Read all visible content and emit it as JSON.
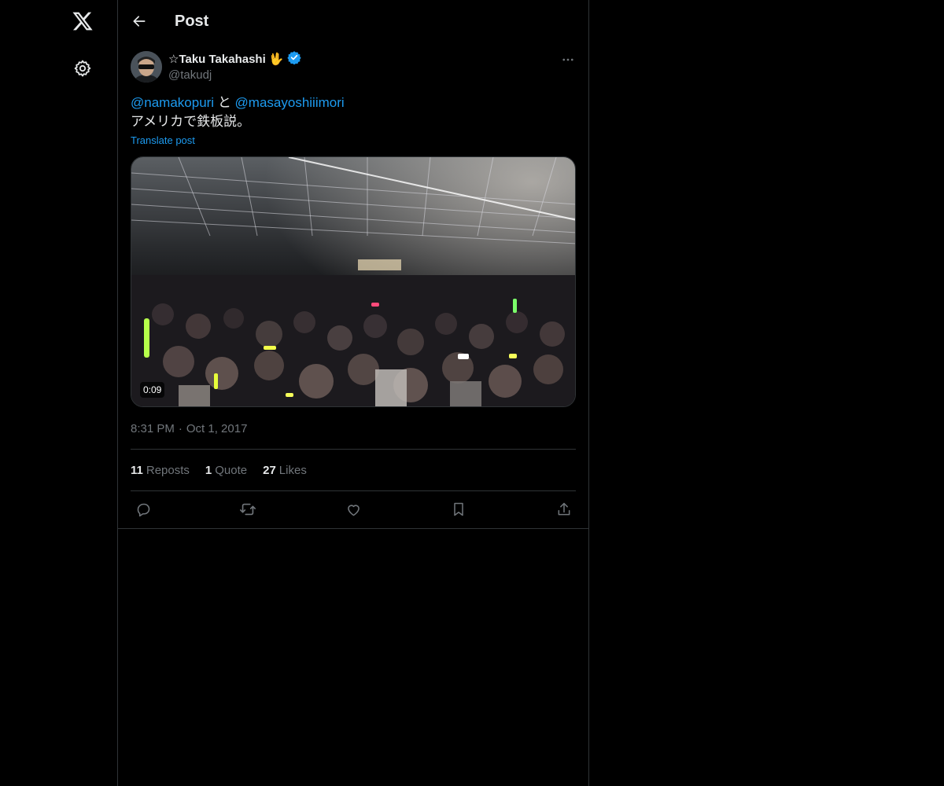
{
  "header": {
    "title": "Post",
    "back_icon": "arrow-left-icon"
  },
  "nav": {
    "logo_icon": "x-logo-icon",
    "settings_icon": "gear-icon"
  },
  "post": {
    "author": {
      "name": "☆Taku Takahashi 🖖",
      "handle": "@takudj",
      "verified": true
    },
    "text": {
      "mention_1": "@namakopuri",
      "connector": " と ",
      "mention_2": "@masayoshiiimori",
      "line_2": "アメリカで鉄板説。"
    },
    "translate_label": "Translate post",
    "media": {
      "duration": "0:09"
    },
    "time": "8:31 PM",
    "separator": "·",
    "date": "Oct 1, 2017",
    "stats": {
      "reposts_count": "11",
      "reposts_label": "Reposts",
      "quotes_count": "1",
      "quotes_label": "Quote",
      "likes_count": "27",
      "likes_label": "Likes"
    }
  },
  "colors": {
    "background": "#000000",
    "text": "#e7e9ea",
    "secondary": "#71767b",
    "accent": "#1d9bf0",
    "border": "#2f3336"
  }
}
